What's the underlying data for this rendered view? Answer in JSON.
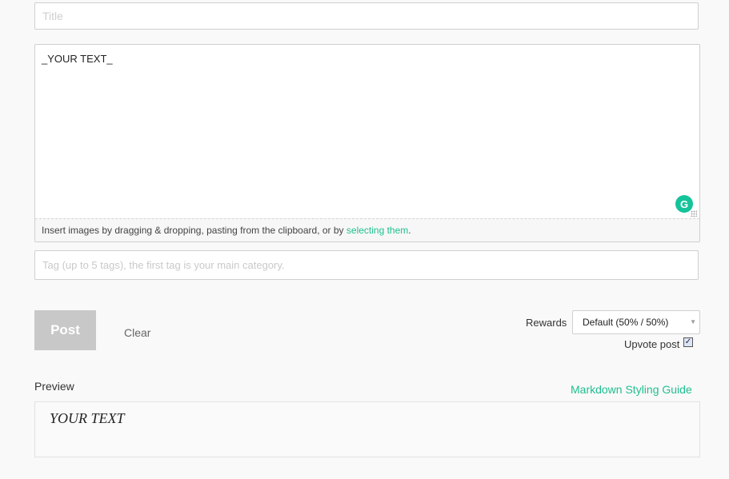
{
  "title_field": {
    "placeholder": "Title",
    "value": ""
  },
  "editor": {
    "value": "_YOUR TEXT_",
    "footer_text": "Insert images by dragging & dropping, pasting from the clipboard, or by ",
    "footer_link": "selecting them",
    "footer_end": ".",
    "grammarly_glyph": "G"
  },
  "tag_field": {
    "placeholder": "Tag (up to 5 tags), the first tag is your main category.",
    "value": ""
  },
  "actions": {
    "post_label": "Post",
    "clear_label": "Clear"
  },
  "rewards": {
    "label": "Rewards",
    "selected": "Default (50% / 50%)"
  },
  "upvote": {
    "label": "Upvote post",
    "checked": true
  },
  "preview": {
    "label": "Preview",
    "guide_link": "Markdown Styling Guide",
    "rendered_text": "YOUR TEXT"
  },
  "colors": {
    "accent": "#1fbf8f",
    "disabled_button": "#c8c8c8",
    "grammarly": "#15c39a"
  },
  "icons": {
    "grammarly": "grammarly-icon",
    "caret": "chevron-down-icon",
    "checkbox": "check-icon"
  }
}
